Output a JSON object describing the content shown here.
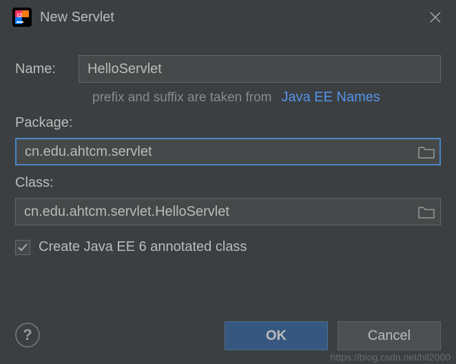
{
  "dialog": {
    "title": "New Servlet"
  },
  "fields": {
    "name_label": "Name:",
    "name_value": "HelloServlet",
    "hint_text": "prefix and suffix are taken from",
    "hint_link": "Java EE Names",
    "package_label": "Package:",
    "package_value": "cn.edu.ahtcm.servlet",
    "class_label": "Class:",
    "class_value": "cn.edu.ahtcm.servlet.HelloServlet"
  },
  "checkbox": {
    "label": "Create Java EE 6 annotated class",
    "checked": true
  },
  "buttons": {
    "ok": "OK",
    "cancel": "Cancel",
    "help": "?"
  },
  "watermark": "https://blog.csdn.net/hil2000"
}
